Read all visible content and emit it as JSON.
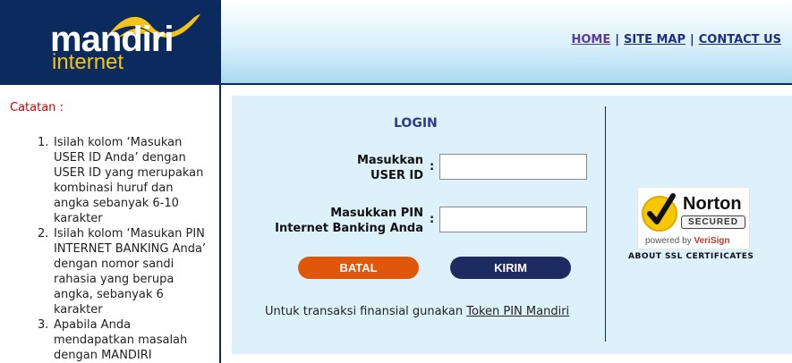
{
  "brand": {
    "name": "mandiri",
    "sub": "internet"
  },
  "nav": {
    "home": "HOME",
    "sitemap": "SITE MAP",
    "contact": "CONTACT US",
    "separator": "|"
  },
  "sidebar": {
    "title": "Catatan :",
    "notes": [
      {
        "num": "1.",
        "text": "Isilah kolom ‘Masukan USER ID Anda’ dengan USER ID yang merupakan kombinasi huruf dan angka sebanyak 6-10 karakter"
      },
      {
        "num": "2.",
        "text": "Isilah kolom ‘Masukan PIN INTERNET BANKING Anda’ dengan nomor sandi rahasia yang berupa angka, sebanyak 6 karakter"
      },
      {
        "num": "3.",
        "text": "Apabila Anda mendapatkan masalah dengan MANDIRI"
      }
    ]
  },
  "login": {
    "title": "LOGIN",
    "userid_label_1": "Masukkan",
    "userid_label_2": "USER ID",
    "pin_label_1": "Masukkan PIN",
    "pin_label_2": "Internet Banking Anda",
    "colon": ":",
    "userid_value": "",
    "pin_value": "",
    "batal_label": "BATAL",
    "kirim_label": "KIRIM",
    "token_prefix": "Untuk transaksi finansial gunakan",
    "token_link": "Token PIN Mandiri"
  },
  "norton": {
    "word": "Norton",
    "secured": "SECURED",
    "powered_by": "powered by",
    "verisign": "VeriSign",
    "ssl_label": "ABOUT SSL CERTIFICATES"
  },
  "colors": {
    "navy": "#0b2a5e",
    "gold": "#f3c316",
    "panel": "#ddf1fa",
    "batal": "#e0570a",
    "kirim": "#1d2b63",
    "note_red": "#cc0000"
  }
}
